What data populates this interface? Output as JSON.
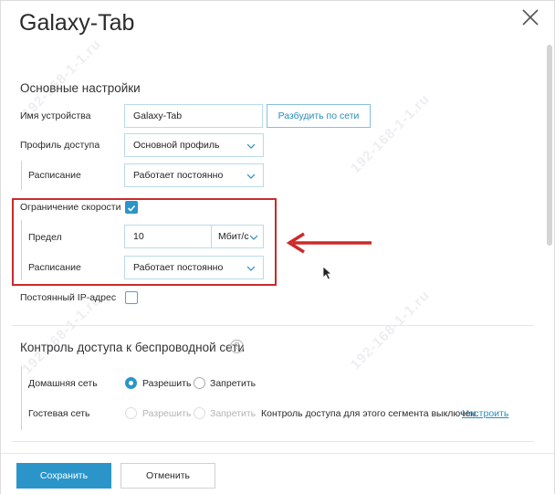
{
  "dialog": {
    "title": "Galaxy-Tab"
  },
  "watermark": "192-168-1-1.ru",
  "basic": {
    "section_title": "Основные настройки",
    "device_name_label": "Имя устройства",
    "device_name_value": "Galaxy-Tab",
    "wake_button": "Разбудить по сети",
    "access_profile_label": "Профиль доступа",
    "access_profile_value": "Основной профиль",
    "schedule_label": "Расписание",
    "schedule_value": "Работает постоянно",
    "speed_limit_label": "Ограничение скорости",
    "speed_limit_checked": true,
    "limit_label": "Предел",
    "limit_value": "10",
    "limit_unit": "Мбит/с",
    "limit_schedule_label": "Расписание",
    "limit_schedule_value": "Работает постоянно",
    "static_ip_label": "Постоянный IP-адрес",
    "static_ip_checked": false
  },
  "wireless": {
    "section_title": "Контроль доступа к беспроводной сети",
    "help_glyph": "?",
    "home_label": "Домашняя сеть",
    "home_allow": "Разрешить",
    "home_deny": "Запретить",
    "guest_label": "Гостевая сеть",
    "guest_allow": "Разрешить",
    "guest_deny": "Запретить",
    "guest_note": "Контроль доступа для этого сегмента выключен.",
    "guest_link": "Настроить"
  },
  "next_section_partial": "",
  "footer": {
    "save": "Сохранить",
    "cancel": "Отменить"
  },
  "colors": {
    "accent": "#2b95c9",
    "highlight": "#cc2a2a"
  }
}
